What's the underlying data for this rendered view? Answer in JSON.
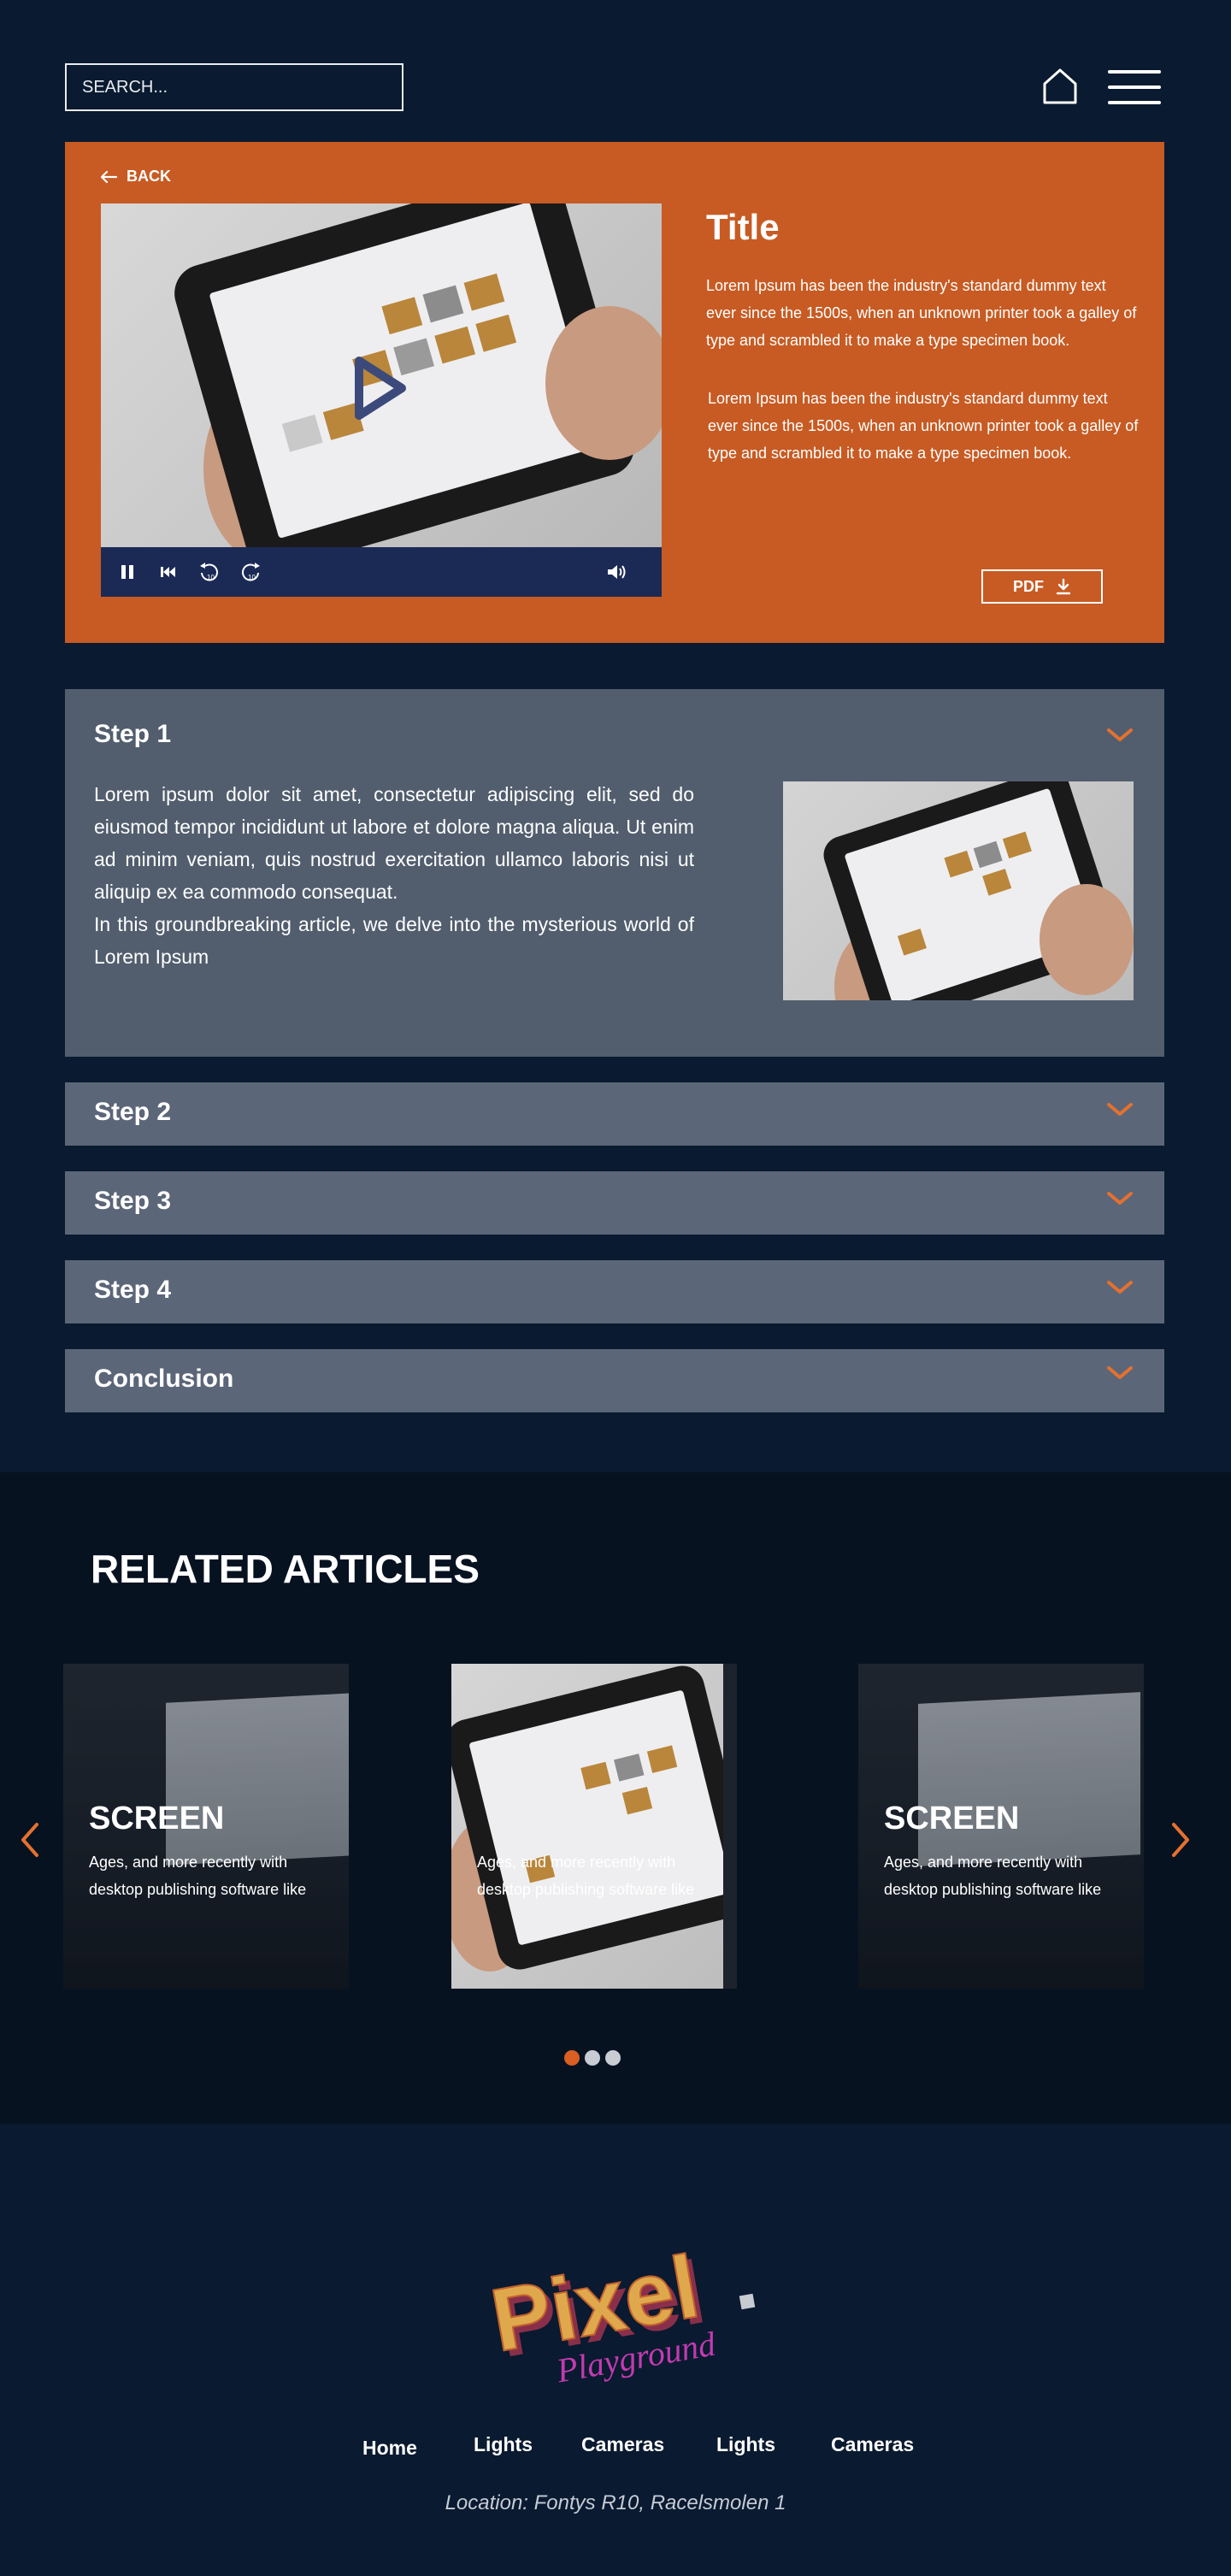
{
  "header": {
    "search_placeholder": "SEARCH...",
    "home_icon": "home-icon",
    "menu_icon": "hamburger-menu-icon"
  },
  "hero": {
    "back_label": "BACK",
    "title": "Title",
    "paragraph_1": "Lorem Ipsum has been the industry's standard dummy text ever since the 1500s, when an unknown printer took a galley of type and scrambled it to make a type specimen book.",
    "paragraph_2": "Lorem Ipsum has been the industry's standard dummy text ever since the 1500s, when an unknown printer took a galley of type and scrambled it to make a type specimen book.",
    "pdf_label": "PDF",
    "video_controls": [
      "pause-icon",
      "skip-back-icon",
      "rewind-10-icon",
      "forward-10-icon",
      "volume-icon"
    ],
    "background_color": "#c75b23"
  },
  "steps": [
    {
      "title": "Step 1",
      "expanded": true,
      "body_1": "Lorem ipsum dolor sit amet, consectetur adipiscing elit, sed do eiusmod tempor incididunt ut labore et dolore magna aliqua. Ut enim ad minim veniam, quis nostrud exercitation ullamco laboris nisi ut aliquip ex ea commodo consequat.",
      "body_2": "In this groundbreaking article, we delve into the mysterious world of Lorem Ipsum"
    },
    {
      "title": "Step 2",
      "expanded": false
    },
    {
      "title": "Step 3",
      "expanded": false
    },
    {
      "title": "Step 4",
      "expanded": false
    },
    {
      "title": "Conclusion",
      "expanded": false
    }
  ],
  "related": {
    "title": "RELATED ARTICLES",
    "cards": [
      {
        "title": "SCREEN",
        "text": "Ages, and more recently with desktop publishing software like"
      },
      {
        "title": "",
        "text": "Ages, and more recently with desktop publishing software like"
      },
      {
        "title": "SCREEN",
        "text": "Ages, and more recently with desktop publishing software like"
      }
    ],
    "active_dot": 0,
    "dot_count": 3,
    "accent_color": "#d95f23"
  },
  "footer": {
    "logo_text": "Pixel",
    "logo_subtext": "Playground",
    "nav": [
      "Home",
      "Lights",
      "Cameras",
      "Lights",
      "Cameras"
    ],
    "location": "Location: Fontys R10, Racelsmolen 1"
  }
}
